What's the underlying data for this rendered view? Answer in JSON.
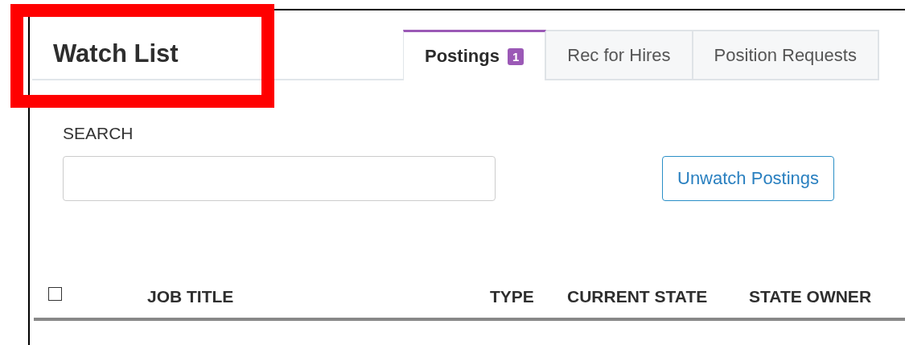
{
  "header": {
    "title": "Watch List",
    "title_highlighted": true
  },
  "tabs": [
    {
      "label": "Postings",
      "badge": "1",
      "selected": true
    },
    {
      "label": "Rec for Hires",
      "selected": false
    },
    {
      "label": "Position Requests",
      "selected": false
    }
  ],
  "search": {
    "label": "SEARCH"
  },
  "actions": [
    {
      "label": "Unwatch Postings"
    }
  ],
  "table": {
    "select_all": {
      "checked": false
    },
    "columns": [
      "JOB TITLE",
      "TYPE",
      "CURRENT STATE",
      "STATE OWNER"
    ]
  }
}
